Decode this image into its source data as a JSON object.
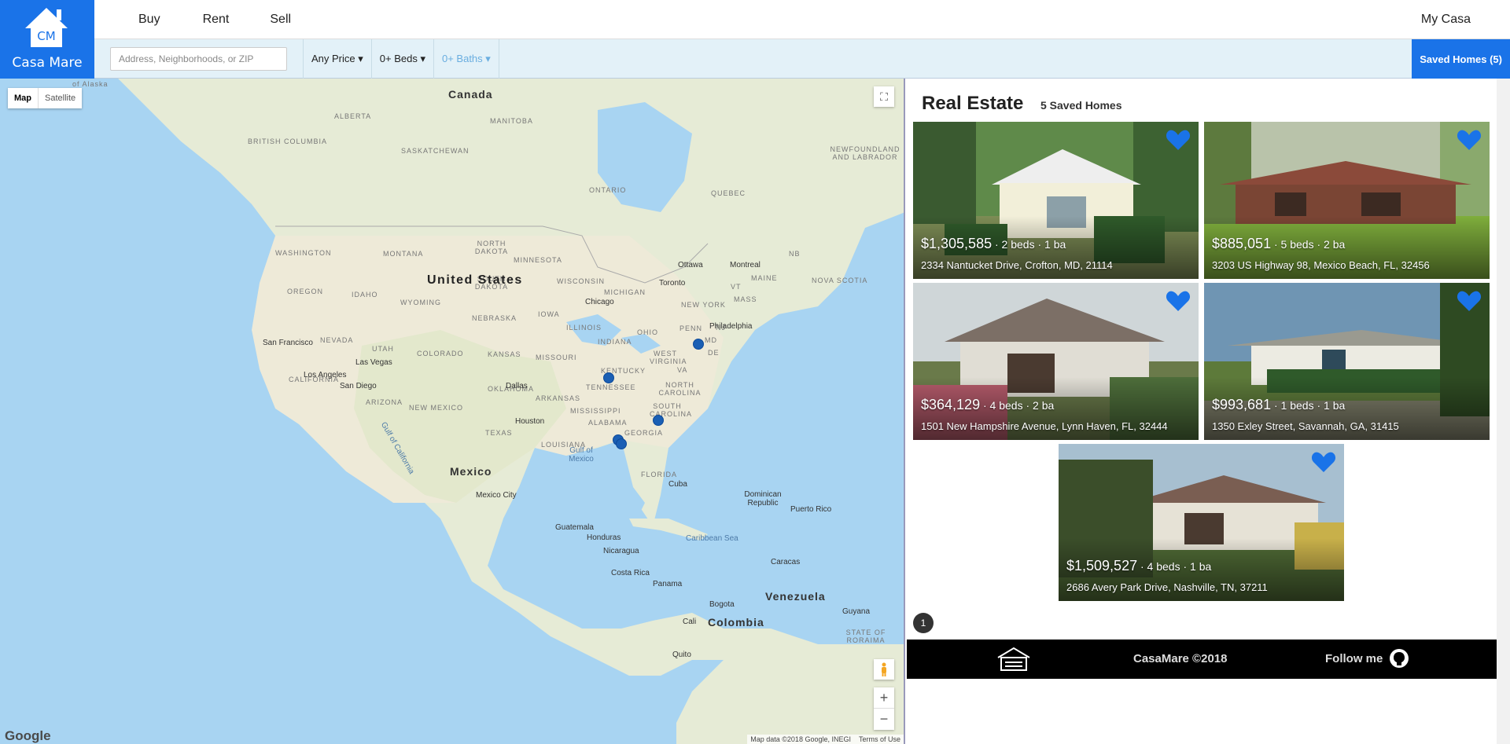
{
  "brand": {
    "initials": "CM",
    "name": "Casa Mare",
    "color": "#1a73e8"
  },
  "nav": {
    "buy": "Buy",
    "rent": "Rent",
    "sell": "Sell",
    "account": "My Casa"
  },
  "filters": {
    "search_placeholder": "Address, Neighborhoods, or ZIP",
    "price": "Any Price ▾",
    "beds": "0+ Beds ▾",
    "baths": "0+ Baths ▾",
    "saved": "Saved Homes (5)"
  },
  "map": {
    "type_map": "Map",
    "type_satellite": "Satellite",
    "logo": "Google",
    "attribution": "Map data ©2018 Google, INEGI",
    "terms": "Terms of Use",
    "labels": {
      "canada": "Canada",
      "united_states": "United States",
      "mexico": "Mexico",
      "cuba": "Cuba",
      "venezuela": "Venezuela",
      "colombia": "Colombia",
      "alberta": "ALBERTA",
      "british_columbia": "BRITISH COLUMBIA",
      "saskatchewan": "SASKATCHEWAN",
      "manitoba": "MANITOBA",
      "ontario": "ONTARIO",
      "quebec": "QUEBEC",
      "newfoundland": "NEWFOUNDLAND AND LABRADOR",
      "washington": "WASHINGTON",
      "montana": "MONTANA",
      "north_dakota": "NORTH DAKOTA",
      "south_dakota": "SOUTH DAKOTA",
      "minnesota": "MINNESOTA",
      "wisconsin": "WISCONSIN",
      "michigan": "MICHIGAN",
      "oregon": "OREGON",
      "idaho": "IDAHO",
      "wyoming": "WYOMING",
      "nebraska": "NEBRASKA",
      "iowa": "IOWA",
      "illinois": "ILLINOIS",
      "indiana": "INDIANA",
      "ohio": "OHIO",
      "penn": "PENN",
      "new_york": "NEW YORK",
      "maine": "MAINE",
      "nevada": "NEVADA",
      "utah": "UTAH",
      "colorado": "COLORADO",
      "kansas": "KANSAS",
      "missouri": "MISSOURI",
      "kentucky": "KENTUCKY",
      "west_virginia": "WEST VIRGINIA",
      "california": "CALIFORNIA",
      "arizona": "ARIZONA",
      "new_mexico": "NEW MEXICO",
      "oklahoma": "OKLAHOMA",
      "arkansas": "ARKANSAS",
      "tennessee": "TENNESSEE",
      "north_carolina": "NORTH CAROLINA",
      "south_carolina": "SOUTH CAROLINA",
      "texas": "TEXAS",
      "mississippi": "MISSISSIPPI",
      "alabama": "ALABAMA",
      "georgia": "GEORGIA",
      "louisiana": "LOUISIANA",
      "florida": "FLORIDA",
      "nova_scotia": "NOVA SCOTIA",
      "nb": "NB",
      "ottawa": "Ottawa",
      "montreal": "Montreal",
      "toronto": "Toronto",
      "chicago": "Chicago",
      "philadelphia": "Philadelphia",
      "san_francisco": "San Francisco",
      "las_vegas": "Las Vegas",
      "los_angeles": "Los Angeles",
      "san_diego": "San Diego",
      "dallas": "Dallas",
      "houston": "Houston",
      "mexico_city": "Mexico City",
      "guatemala": "Guatemala",
      "honduras": "Honduras",
      "nicaragua": "Nicaragua",
      "costa_rica": "Costa Rica",
      "panama": "Panama",
      "caracas": "Caracas",
      "bogota": "Bogota",
      "guyana": "Guyana",
      "dominican_republic": "Dominican Republic",
      "puerto_rico": "Puerto Rico",
      "caribbean_sea": "Caribbean Sea",
      "gulf_mexico": "Gulf of Mexico",
      "gulf_california": "Gulf of California",
      "cali": "Cali",
      "quito": "Quito",
      "vt": "VT",
      "mass": "MASS",
      "md": "MD",
      "nj": "NJ",
      "de": "DE",
      "va": "VA",
      "state_roraima": "STATE OF RORAIMA",
      "alaska": "of Alaska"
    }
  },
  "listings": {
    "title": "Real Estate",
    "count_label": "5 Saved Homes",
    "page": "1",
    "homes": [
      {
        "price": "$1,305,585",
        "beds": "2 beds",
        "baths": "1 ba",
        "address": "2334 Nantucket Drive, Crofton, MD, 21114"
      },
      {
        "price": "$885,051",
        "beds": "5 beds",
        "baths": "2 ba",
        "address": "3203 US Highway 98, Mexico Beach, FL, 32456"
      },
      {
        "price": "$364,129",
        "beds": "4 beds",
        "baths": "2 ba",
        "address": "1501 New Hampshire Avenue, Lynn Haven, FL, 32444"
      },
      {
        "price": "$993,681",
        "beds": "1 beds",
        "baths": "1 ba",
        "address": "1350 Exley Street, Savannah, GA, 31415"
      },
      {
        "price": "$1,509,527",
        "beds": "4 beds",
        "baths": "1 ba",
        "address": "2686 Avery Park Drive, Nashville, TN, 37211"
      }
    ]
  },
  "footer": {
    "copyright": "CasaMare ©2018",
    "follow": "Follow me"
  },
  "icons": {
    "heart": "heart-icon",
    "github": "github-icon",
    "home": "home-icon",
    "fullscreen": "fullscreen-icon",
    "pegman": "pegman-icon"
  }
}
